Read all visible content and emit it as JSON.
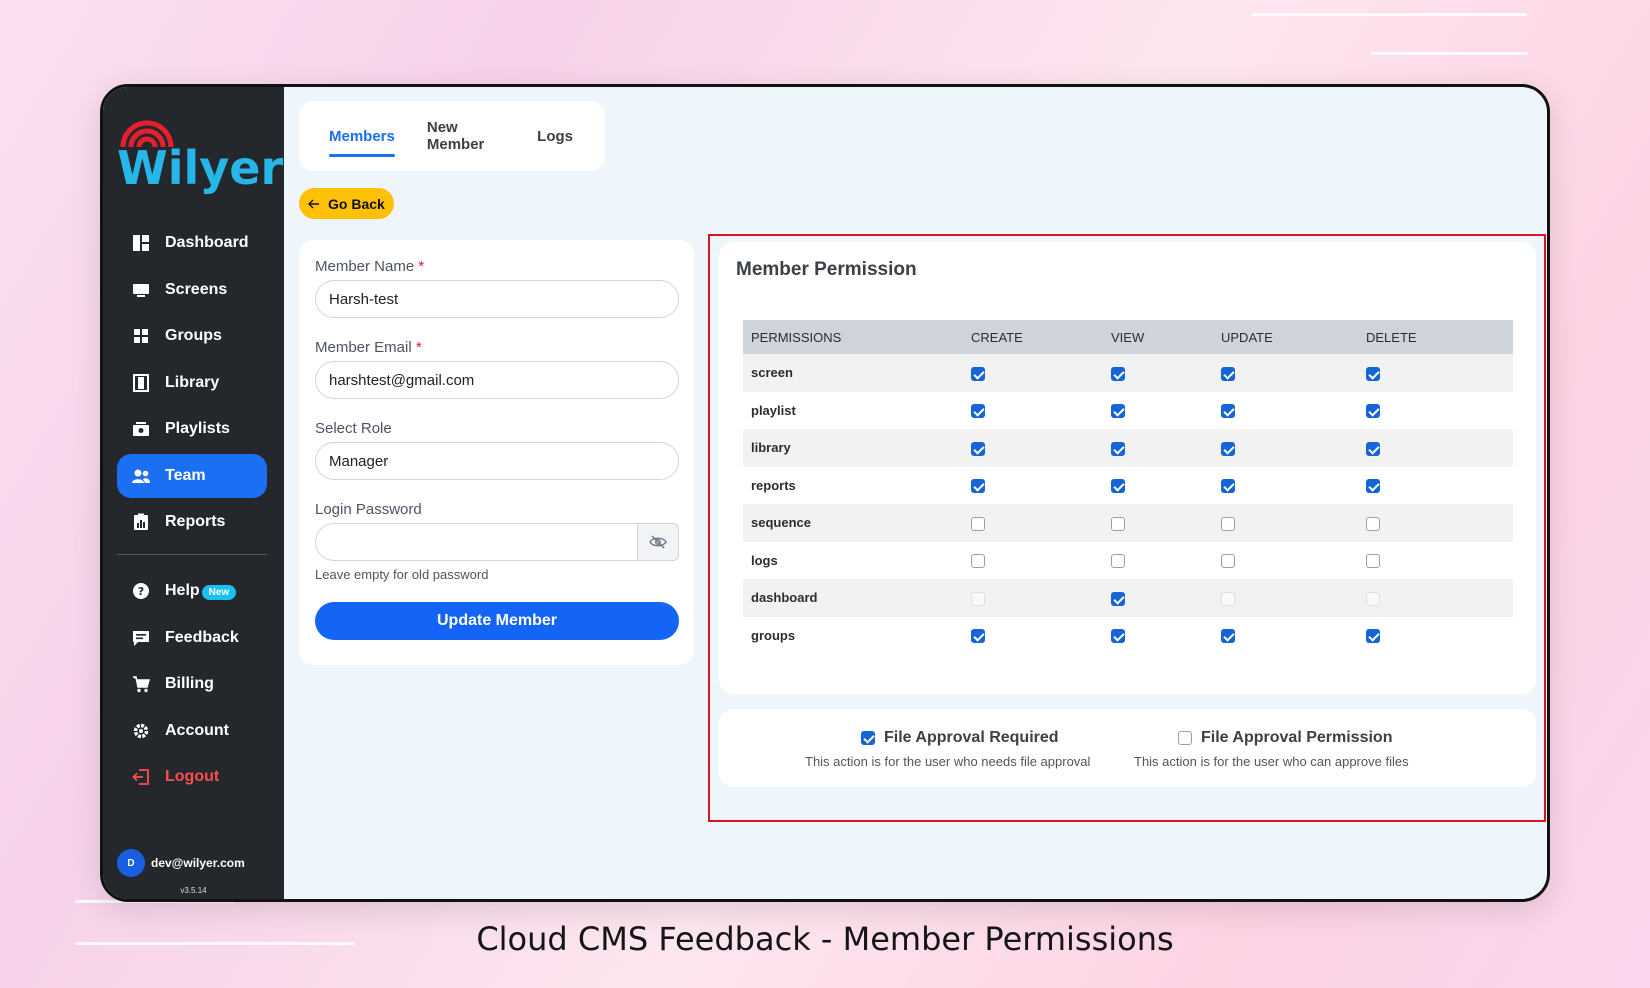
{
  "brand": {
    "name": "Wilyer",
    "arc_color": "#e5202e",
    "text_color": "#26b7e8"
  },
  "sidebar": {
    "items": [
      {
        "label": "Dashboard",
        "icon": "dashboard-icon"
      },
      {
        "label": "Screens",
        "icon": "monitor-icon"
      },
      {
        "label": "Groups",
        "icon": "grid-icon"
      },
      {
        "label": "Library",
        "icon": "film-icon"
      },
      {
        "label": "Playlists",
        "icon": "playlist-icon"
      },
      {
        "label": "Team",
        "icon": "team-icon",
        "active": true
      },
      {
        "label": "Reports",
        "icon": "report-icon"
      }
    ],
    "secondary": [
      {
        "label": "Help",
        "icon": "help-icon",
        "badge": "New"
      },
      {
        "label": "Feedback",
        "icon": "feedback-icon"
      },
      {
        "label": "Billing",
        "icon": "cart-icon"
      },
      {
        "label": "Account",
        "icon": "gear-icon"
      },
      {
        "label": "Logout",
        "icon": "logout-icon"
      }
    ],
    "user": {
      "initial": "D",
      "email": "dev@wilyer.com"
    },
    "version": "v3.5.14"
  },
  "tabs": [
    {
      "label": "Members",
      "active": true
    },
    {
      "label": "New Member"
    },
    {
      "label": "Logs"
    }
  ],
  "go_back": "Go Back",
  "form": {
    "name_label": "Member Name",
    "name_value": "Harsh-test",
    "email_label": "Member Email",
    "email_value": "harshtest@gmail.com",
    "role_label": "Select Role",
    "role_value": "Manager",
    "password_label": "Login Password",
    "password_value": "",
    "password_hint": "Leave empty for old password",
    "required_mark": "*",
    "submit": "Update Member"
  },
  "permissions": {
    "title": "Member Permission",
    "columns": [
      "PERMISSIONS",
      "CREATE",
      "VIEW",
      "UPDATE",
      "DELETE"
    ],
    "rows": [
      {
        "name": "screen",
        "create": "checked",
        "view": "checked",
        "update": "checked",
        "delete": "checked"
      },
      {
        "name": "playlist",
        "create": "checked",
        "view": "checked",
        "update": "checked",
        "delete": "checked"
      },
      {
        "name": "library",
        "create": "checked",
        "view": "checked",
        "update": "checked",
        "delete": "checked"
      },
      {
        "name": "reports",
        "create": "checked",
        "view": "checked",
        "update": "checked",
        "delete": "checked"
      },
      {
        "name": "sequence",
        "create": "unchecked",
        "view": "unchecked",
        "update": "unchecked",
        "delete": "unchecked"
      },
      {
        "name": "logs",
        "create": "unchecked",
        "view": "unchecked",
        "update": "unchecked",
        "delete": "unchecked"
      },
      {
        "name": "dashboard",
        "create": "disabled",
        "view": "checked",
        "update": "disabled",
        "delete": "disabled"
      },
      {
        "name": "groups",
        "create": "checked",
        "view": "checked",
        "update": "checked",
        "delete": "checked"
      }
    ]
  },
  "approval": {
    "required": {
      "label": "File Approval Required",
      "desc": "This action is for the user who needs file approval",
      "checked": true
    },
    "permission": {
      "label": "File Approval Permission",
      "desc": "This action is for the user who can approve files",
      "checked": false
    }
  },
  "caption": "Cloud CMS Feedback - Member Permissions",
  "colors": {
    "primary": "#1464f5",
    "highlight": "#d9141e",
    "go_back": "#ffc107",
    "sidebar": "#24272c"
  }
}
